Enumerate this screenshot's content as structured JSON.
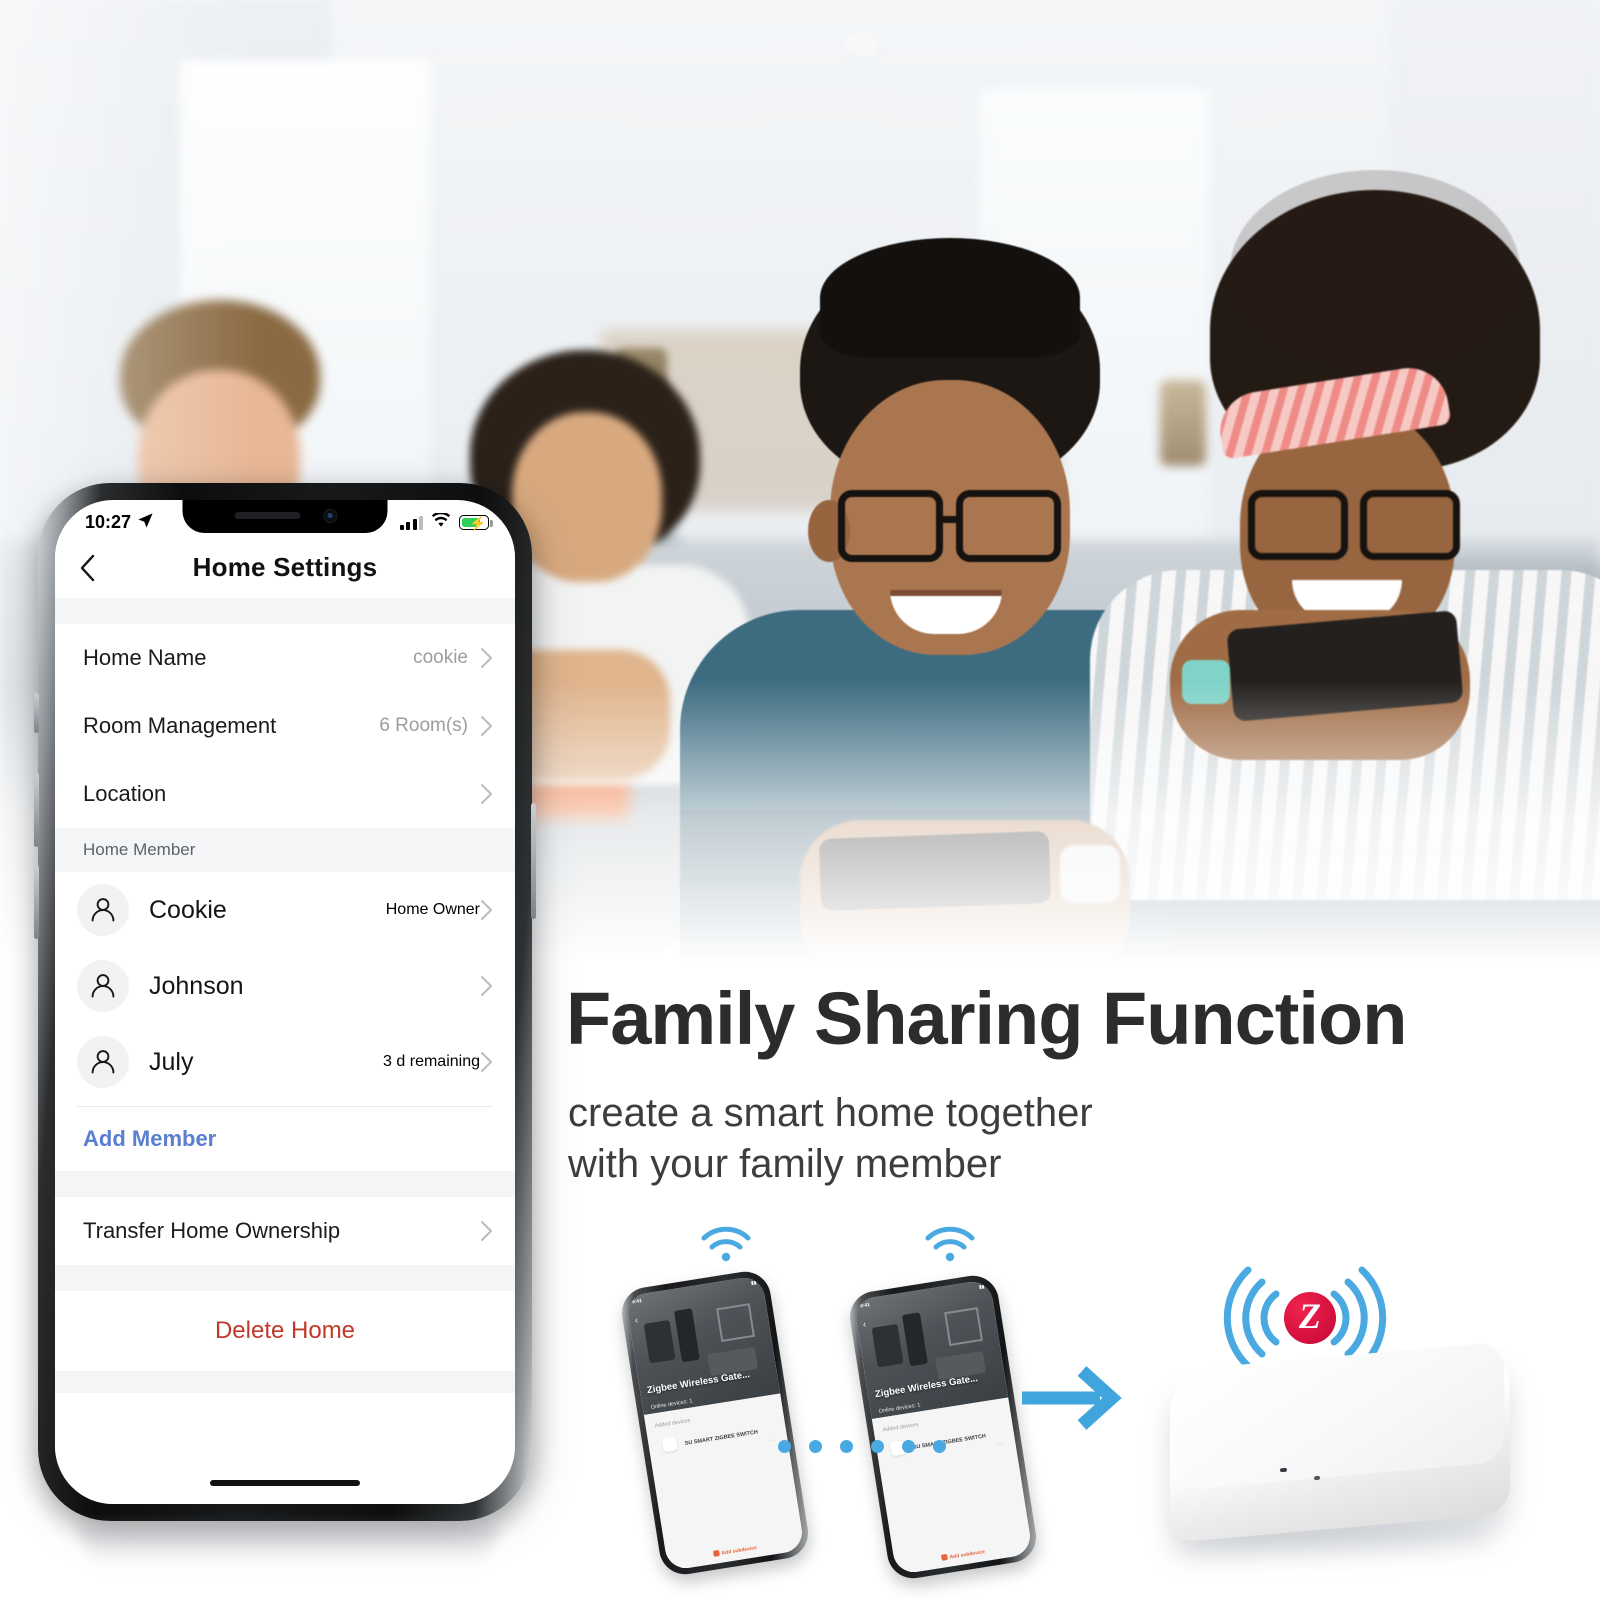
{
  "marketing": {
    "headline": "Family Sharing Function",
    "subtitle_line1": "create a smart home together",
    "subtitle_line2": "with your family member"
  },
  "colors": {
    "accent_blue": "#4aa9e0",
    "link_blue": "#5b7fd0",
    "danger_red": "#c0392b",
    "zigbee_red": "#d10f3c",
    "battery_green": "#30d158"
  },
  "phone": {
    "status_bar": {
      "time": "10:27",
      "location_icon": "location-arrow-icon",
      "signal_icon": "cellular-bars-icon",
      "wifi_icon": "wifi-icon",
      "battery_icon": "battery-charging-icon"
    },
    "nav": {
      "back_icon": "chevron-left-icon",
      "title": "Home Settings"
    },
    "settings_rows": [
      {
        "label": "Home Name",
        "value": "cookie",
        "chevron": "chevron-right-icon"
      },
      {
        "label": "Room Management",
        "value": "6 Room(s)",
        "chevron": "chevron-right-icon"
      },
      {
        "label": "Location",
        "value": "",
        "chevron": "chevron-right-icon"
      }
    ],
    "member_section": {
      "header": "Home Member",
      "members": [
        {
          "name": "Cookie",
          "role": "Home Owner",
          "role_style": "normal",
          "avatar": "person-avatar-icon"
        },
        {
          "name": "Johnson",
          "role": "",
          "role_style": "normal",
          "avatar": "person-avatar-icon"
        },
        {
          "name": "July",
          "role": "3 d remaining",
          "role_style": "red",
          "avatar": "person-avatar-icon"
        }
      ],
      "add_member_label": "Add Member"
    },
    "transfer_row": {
      "label": "Transfer Home Ownership",
      "chevron": "chevron-right-icon"
    },
    "delete_label": "Delete Home"
  },
  "diagram": {
    "mini_phone": {
      "status_time": "9:41",
      "back_icon": "chevron-left-icon",
      "hero_title": "Zigbee Wireless Gate...",
      "hero_subtitle": "Online devices: 1",
      "list_header": "Added devices",
      "device_name": "SU SMART ZIGBEE SWITCH",
      "more_icon": "ellipsis-icon",
      "footer_label": "Add subdevice"
    },
    "wifi_icon": "wifi-signal-icon",
    "arrow_icon": "arrow-right-icon",
    "connector": "dotted-line",
    "gateway": {
      "device_name": "zigbee-gateway-hub",
      "badge_letter": "Z",
      "signal_icon": "radio-waves-icon"
    }
  }
}
